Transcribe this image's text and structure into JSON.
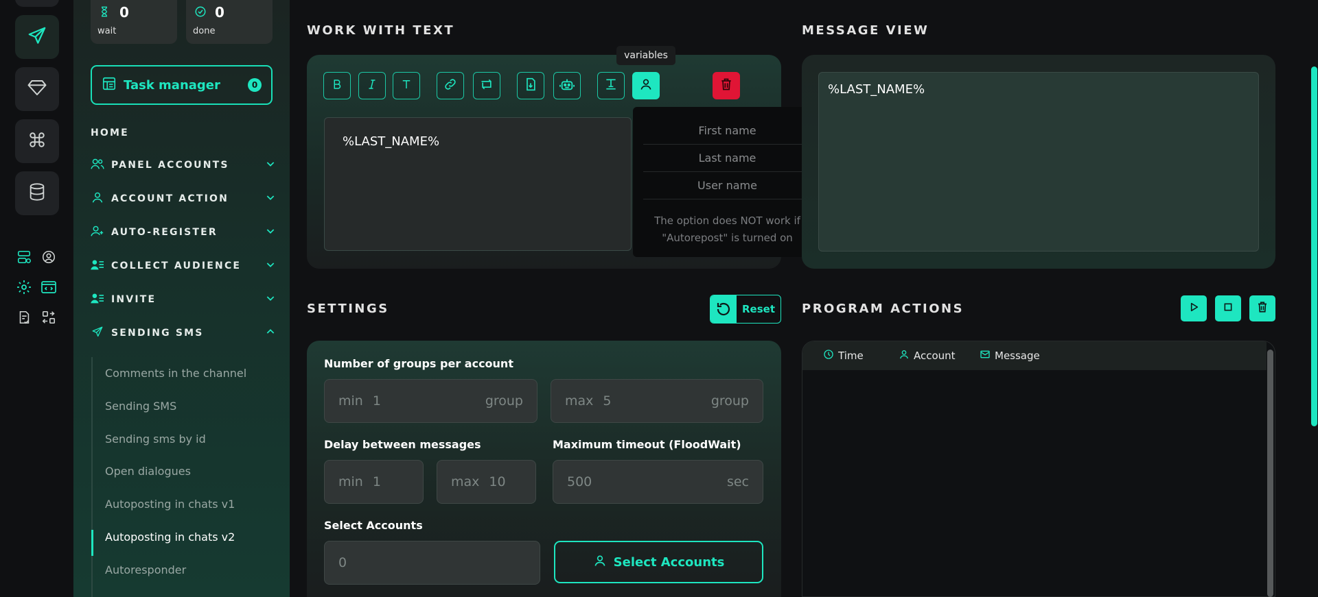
{
  "stats": {
    "wait": {
      "value": "0",
      "label": "wait"
    },
    "done": {
      "value": "0",
      "label": "done"
    }
  },
  "task_manager": {
    "label": "Task manager",
    "badge": "0"
  },
  "nav": {
    "home": "HOME",
    "panel_accounts": "PANEL ACCOUNTS",
    "account_action": "ACCOUNT ACTION",
    "auto_register": "AUTO-REGISTER",
    "collect_audience": "COLLECT AUDIENCE",
    "invite": "INVITE",
    "sending_sms": "SENDING SMS",
    "sub_items": [
      "Comments in the channel",
      "Sending SMS",
      "Sending sms by id",
      "Open dialogues",
      "Autoposting in chats v1",
      "Autoposting in chats v2",
      "Autoresponder"
    ],
    "active_sub_index": 5
  },
  "work_with_text": {
    "title": "WORK WITH TEXT",
    "tooltip": "variables",
    "text": "%LAST_NAME%",
    "variables_menu": [
      "First name",
      "Last name",
      "User name"
    ],
    "note": "The option does NOT work if \"Autorepost\" is turned on"
  },
  "message_view": {
    "title": "MESSAGE VIEW",
    "text": "%LAST_NAME%"
  },
  "settings": {
    "title": "SETTINGS",
    "reset": "Reset",
    "groups_label": "Number of groups per account",
    "groups_min_prefix": "min",
    "groups_min": "1",
    "groups_max_prefix": "max",
    "groups_max": "5",
    "group_unit": "group",
    "delay_label": "Delay between messages",
    "delay_min_prefix": "min",
    "delay_min": "1",
    "delay_max_prefix": "max",
    "delay_max": "10",
    "timeout_label": "Maximum timeout (FloodWait)",
    "timeout_value": "500",
    "timeout_unit": "sec",
    "accounts_label": "Select Accounts",
    "accounts_value": "0",
    "select_accounts_button": "Select Accounts"
  },
  "program_actions": {
    "title": "PROGRAM ACTIONS",
    "columns": [
      "Time",
      "Account",
      "Message"
    ]
  },
  "colors": {
    "accent": "#1ee6c0",
    "danger": "#e01535",
    "background": "#101113"
  }
}
